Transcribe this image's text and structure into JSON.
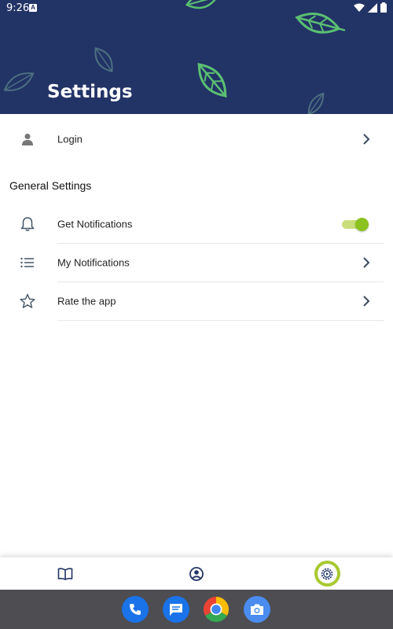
{
  "status_bar": {
    "time": "9:26",
    "indicator": "A"
  },
  "header": {
    "title": "Settings",
    "background_color": "#223366",
    "leaf_color": "#5bbf72"
  },
  "account_row": {
    "label": "Login",
    "icon": "person-icon"
  },
  "general_settings": {
    "title": "General Settings",
    "items": [
      {
        "label": "Get Notifications",
        "icon": "bell-icon",
        "control": "toggle",
        "enabled": true
      },
      {
        "label": "My Notifications",
        "icon": "list-icon",
        "control": "chevron"
      },
      {
        "label": "Rate the app",
        "icon": "star-icon",
        "control": "chevron"
      }
    ]
  },
  "bottom_nav": {
    "items": [
      {
        "icon": "book-icon",
        "active": false
      },
      {
        "icon": "account-circle-icon",
        "active": false
      },
      {
        "icon": "settings-icon",
        "active": true
      }
    ],
    "active_color": "#a8c930"
  },
  "dock": {
    "apps": [
      "phone-icon",
      "messages-icon",
      "chrome-icon",
      "camera-icon"
    ]
  }
}
